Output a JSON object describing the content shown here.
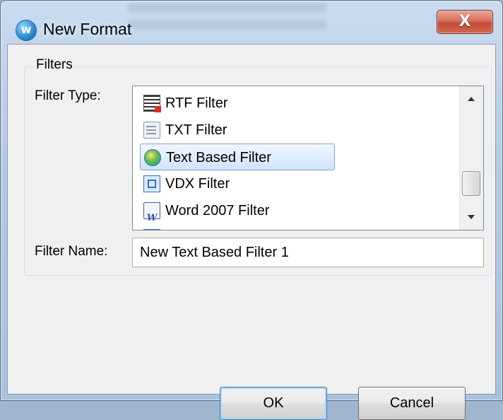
{
  "window": {
    "title": "New Format",
    "close_glyph": "X",
    "app_icon": "app-logo-icon",
    "close_icon": "close-icon"
  },
  "group": {
    "title": "Filters",
    "filter_type_label": "Filter Type:",
    "filter_name_label": "Filter Name:"
  },
  "filter_list": {
    "items": [
      {
        "label": "RTF Filter",
        "icon": "rtf-file-icon",
        "selected": false
      },
      {
        "label": "TXT Filter",
        "icon": "txt-file-icon",
        "selected": false
      },
      {
        "label": "Text Based Filter",
        "icon": "text-based-filter-icon",
        "selected": true
      },
      {
        "label": "VDX Filter",
        "icon": "vdx-file-icon",
        "selected": false
      },
      {
        "label": "Word 2007 Filter",
        "icon": "word-file-icon",
        "selected": false
      },
      {
        "label": "",
        "icon": "partial-item-icon",
        "selected": false
      }
    ],
    "scroll_position": 0.6
  },
  "filter_name": {
    "value": "New Text Based Filter 1"
  },
  "buttons": {
    "ok": "OK",
    "cancel": "Cancel"
  },
  "colors": {
    "selection": "#cfe4fd",
    "selection_border": "#7da2ce",
    "close_button": "#c24a34",
    "default_button_border": "#3c7fb1"
  }
}
